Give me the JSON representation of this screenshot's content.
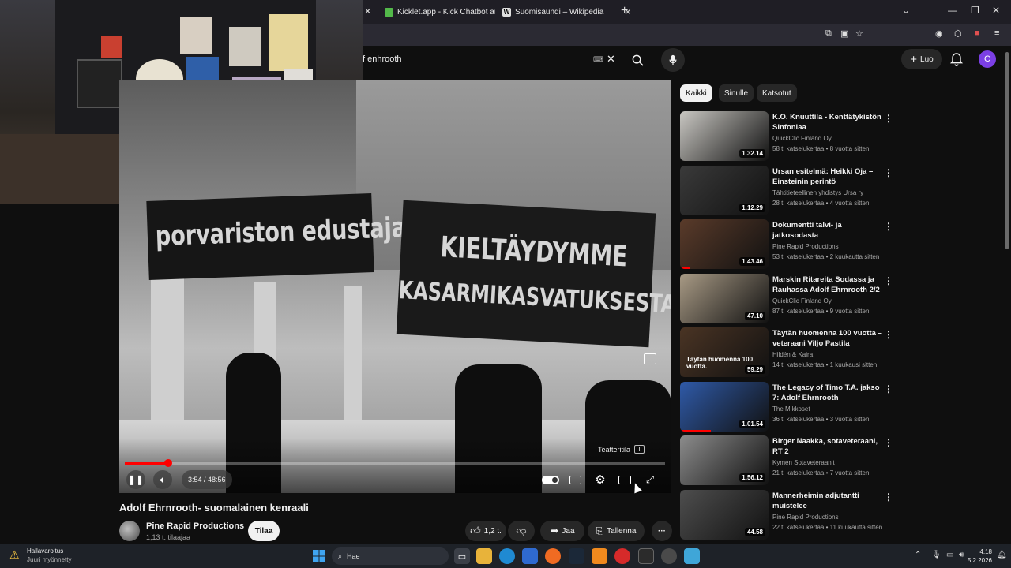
{
  "browser": {
    "tabs": [
      {
        "title": "Kicklet.app - Kick Chatbot and C",
        "icon": "kicklet-favicon",
        "color": "#53b94a"
      },
      {
        "title": "Suomisaundi – Wikipedia",
        "icon": "wikipedia-favicon",
        "color": "#e0e0e0"
      }
    ],
    "wiki_icon_letter": "W"
  },
  "header": {
    "search_query": "f enhrooth",
    "create_label": "Luo",
    "avatar_letter": "C"
  },
  "player": {
    "banner_left": "porvariston edustajat !",
    "banner_right_line1": "KIELTÄYDYMME",
    "banner_right_line2": "KASARMIKASVATUKSESTA",
    "time": "3:54 / 48:56",
    "progress_fraction": 0.0797,
    "theater_tooltip": "Teatteritila",
    "theater_key": "T"
  },
  "video": {
    "title": "Adolf Ehrnrooth- suomalainen kenraali",
    "channel": "Pine Rapid Productions",
    "subscribers": "1,13 t. tilaajaa",
    "subscribe_label": "Tilaa",
    "likes": "1,2 t.",
    "share_label": "Jaa",
    "save_label": "Tallenna"
  },
  "sidebar": {
    "chips": [
      "Kaikki",
      "Sinulle",
      "Katsotut"
    ],
    "recommendations": [
      {
        "title": "K.O. Knuuttila - Kenttätykistön Sinfoniaa",
        "channel": "QuickClic Finland Oy",
        "meta": "58 t. katselukertaa • 8 vuotta sitten",
        "duration": "1.32.14",
        "bg": "#c9c7c2",
        "watched": 0
      },
      {
        "title": "Ursan esitelmä: Heikki Oja – Einsteinin perintö",
        "channel": "Tähtitieteellinen yhdistys Ursa ry",
        "meta": "28 t. katselukertaa • 4 vuotta sitten",
        "duration": "1.12.29",
        "bg": "#3a3a3a",
        "watched": 0
      },
      {
        "title": "Dokumentti talvi- ja jatkosodasta",
        "channel": "Pine Rapid Productions",
        "meta": "53 t. katselukertaa • 2 kuukautta sitten",
        "duration": "1.43.46",
        "bg": "#5a3b2a",
        "watched": 0.12
      },
      {
        "title": "Marskin Ritareita Sodassa ja Rauhassa Adolf Ehrnrooth 2/2",
        "channel": "QuickClic Finland Oy",
        "meta": "87 t. katselukertaa • 9 vuotta sitten",
        "duration": "47.10",
        "bg": "#a89a85",
        "watched": 0
      },
      {
        "title": "Täytän huomenna 100 vuotta – veteraani Viljo Pastila",
        "channel": "Hildén & Kaira",
        "meta": "14 t. katselukertaa • 1 kuukausi sitten",
        "duration": "59.29",
        "bg": "#4a3424",
        "watched": 0,
        "tag": "Täytän huomenna 100 vuotta."
      },
      {
        "title": "The Legacy of Timo T.A. jakso 7: Adolf Ehrnrooth",
        "channel": "The Mikkoset",
        "meta": "36 t. katselukertaa • 3 vuotta sitten",
        "duration": "1.01.54",
        "bg": "#2f5aa8",
        "watched": 0.35
      },
      {
        "title": "Birger Naakka, sotaveteraani, RT 2",
        "channel": "Kymen Sotaveteraanit",
        "meta": "21 t. katselukertaa • 7 vuotta sitten",
        "duration": "1.56.12",
        "bg": "#8c8c8c",
        "watched": 0
      },
      {
        "title": "Mannerheimin adjutantti muistelee",
        "channel": "Pine Rapid Productions",
        "meta": "22 t. katselukertaa • 11 kuukautta sitten",
        "duration": "44.58",
        "bg": "#4e4e4e",
        "watched": 0
      }
    ]
  },
  "taskbar": {
    "warning_title": "Hallavaroitus",
    "warning_sub": "Juuri myönnetty",
    "search_placeholder": "Hae",
    "time": "4.18",
    "date": "5.2.2026"
  }
}
